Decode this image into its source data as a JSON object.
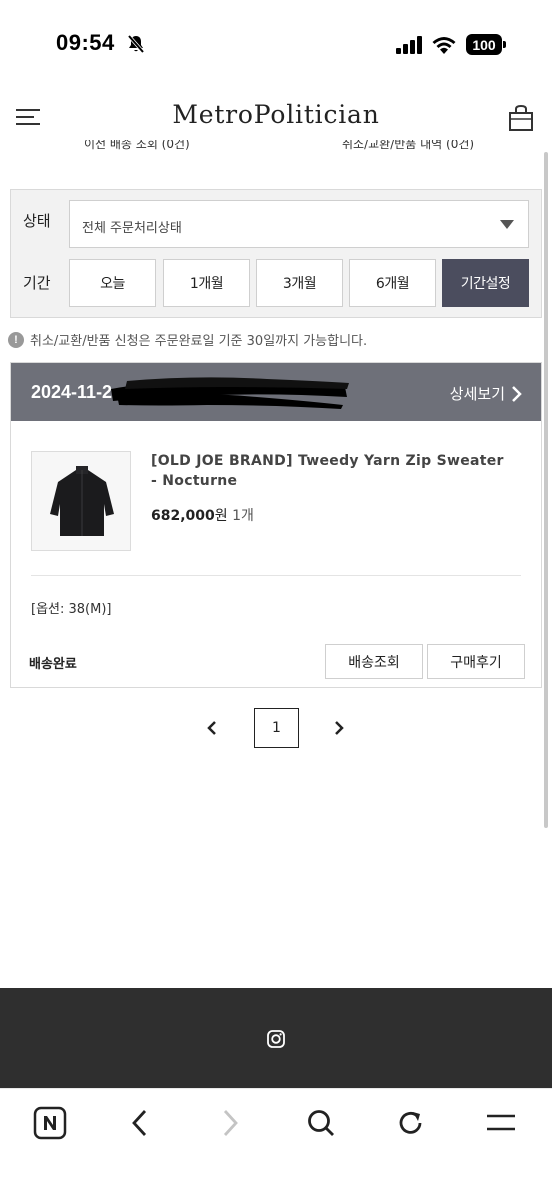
{
  "status_bar": {
    "time": "09:54",
    "battery": "100"
  },
  "header": {
    "brand": "MetroPolitician",
    "cut_left": "이전 배송 조회 (0건)",
    "cut_right": "취소/교환/반품 내역 (0건)"
  },
  "filter": {
    "status_label": "상태",
    "status_value": "전체 주문처리상태",
    "period_label": "기간",
    "period_buttons": [
      "오늘",
      "1개월",
      "3개월",
      "6개월",
      "기간설정"
    ],
    "active_period": "기간설정"
  },
  "notice": {
    "icon": "info-icon",
    "text": "취소/교환/반품 신청은 주문완료일 기준 30일까지 가능합니다."
  },
  "order": {
    "date": "2024-11-2",
    "detail_label": "상세보기",
    "product_name": "[OLD JOE BRAND] Tweedy Yarn Zip Sweater - Nocturne",
    "price": "682,000",
    "currency": "원",
    "quantity": "1개",
    "option": "[옵션: 38(M)]",
    "status": "배송완료",
    "track_label": "배송조회",
    "review_label": "구매후기"
  },
  "pagination": {
    "current": "1"
  },
  "colors": {
    "active_button": "#4b4d5e",
    "order_header": "#6e7079",
    "footer": "#2f2f2f"
  }
}
